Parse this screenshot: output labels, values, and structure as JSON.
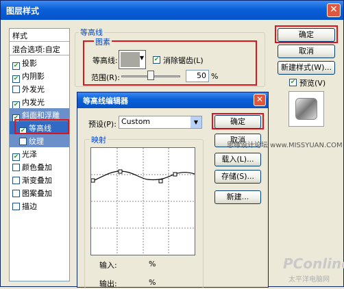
{
  "window": {
    "title": "图层样式"
  },
  "sidebar": {
    "items": [
      {
        "label": "样式",
        "checked": null
      },
      {
        "label": "混合选项:自定",
        "checked": null
      },
      {
        "label": "投影",
        "checked": true
      },
      {
        "label": "内阴影",
        "checked": true
      },
      {
        "label": "外发光",
        "checked": false
      },
      {
        "label": "内发光",
        "checked": true
      },
      {
        "label": "斜面和浮雕",
        "checked": true
      },
      {
        "label": "等高线",
        "checked": true
      },
      {
        "label": "纹理",
        "checked": false
      },
      {
        "label": "光泽",
        "checked": true
      },
      {
        "label": "颜色叠加",
        "checked": false
      },
      {
        "label": "渐变叠加",
        "checked": false
      },
      {
        "label": "图案叠加",
        "checked": false
      },
      {
        "label": "描边",
        "checked": false
      }
    ]
  },
  "contour": {
    "group_title": "等高线",
    "subgroup_title": "图素",
    "contour_label": "等高线:",
    "antialias_label": "消除锯齿(L)",
    "range_label": "范围(R):",
    "range_value": "50",
    "range_unit": "%",
    "range_fraction": 0.5
  },
  "buttons": {
    "ok": "确定",
    "cancel": "取消",
    "new_style": "新建样式(W)...",
    "preview": "预览(V)"
  },
  "editor": {
    "title": "等高线编辑器",
    "preset_label": "预设(P):",
    "preset_value": "Custom",
    "mapping_label": "映射",
    "input_label": "输入:",
    "input_unit": "%",
    "output_label": "输出:",
    "output_unit": "%",
    "ok": "确定",
    "cancel": "取消",
    "load": "载入(L)...",
    "save": "存储(S)...",
    "new": "新建..."
  },
  "watermarks": {
    "site": "思缘设计论坛 www.MISSYUAN.COM",
    "brand": "PConline",
    "brand_sub": "太平洋电脑网"
  }
}
